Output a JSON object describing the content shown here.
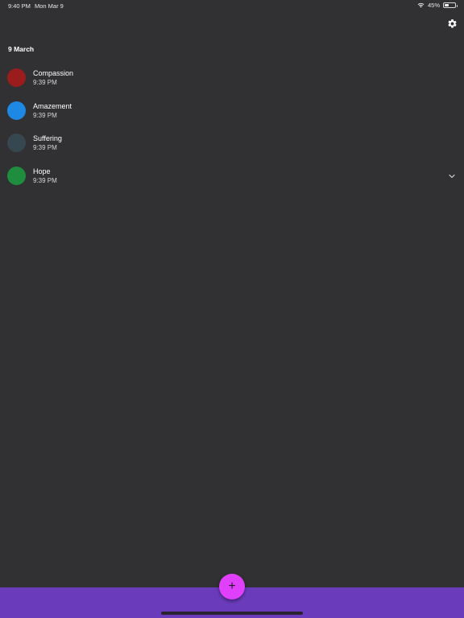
{
  "status_bar": {
    "time": "9:40 PM",
    "date": "Mon Mar 9",
    "battery": "45%",
    "battery_level": 0.45,
    "icons": [
      "wifi-icon",
      "battery-icon"
    ]
  },
  "header": {
    "settings_icon": "gear-icon"
  },
  "list": {
    "date_header": "9 March",
    "entries": [
      {
        "name": "Compassion",
        "time": "9:39 PM",
        "color": "#9b1c1c"
      },
      {
        "name": "Amazement",
        "time": "9:39 PM",
        "color": "#1e88e5"
      },
      {
        "name": "Suffering",
        "time": "9:39 PM",
        "color": "#37474f"
      },
      {
        "name": "Hope",
        "time": "9:39 PM",
        "color": "#1e8e3e",
        "expand_icon": "chevron-down-icon"
      }
    ]
  },
  "fab": {
    "label": "+",
    "color": "#e040fb"
  },
  "theme": {
    "background": "#313033",
    "bottom_bar": "#6a3cbc"
  }
}
